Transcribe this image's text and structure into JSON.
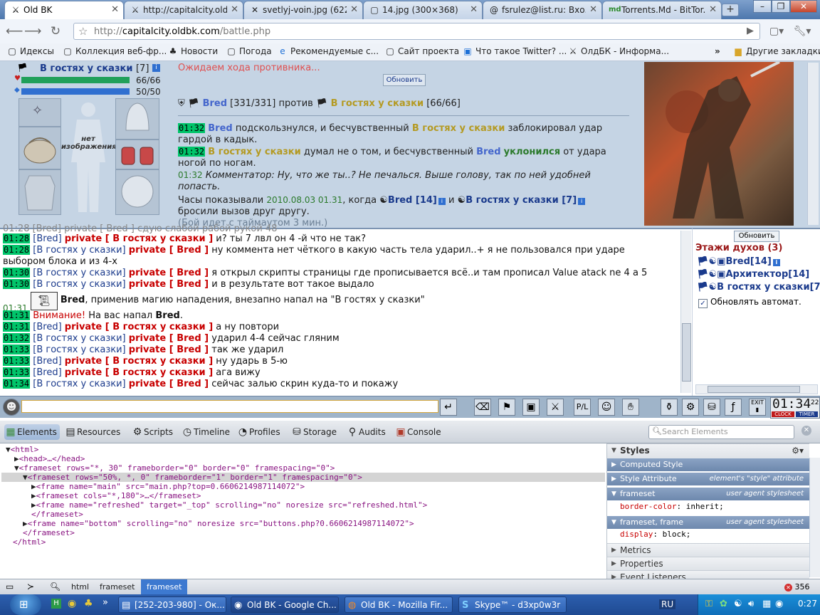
{
  "browser": {
    "tabs": [
      {
        "icon": "⚔",
        "label": "Old BK"
      },
      {
        "icon": "⚔",
        "label": "http://capitalcity.old..."
      },
      {
        "icon": "✕",
        "label": "svetlyj-voin.jpg (622..."
      },
      {
        "icon": "▢",
        "label": "14.jpg (300×368)"
      },
      {
        "icon": "@",
        "label": "fsrulez@list.ru: Вхо..."
      },
      {
        "icon": "md",
        "label": "Torrents.Md - BitTor..."
      }
    ],
    "url_prefix": "http://",
    "url_domain": "capitalcity.oldbk.com",
    "url_path": "/battle.php",
    "bookmarks": [
      {
        "icon": "▢",
        "label": "Идексы"
      },
      {
        "icon": "▢",
        "label": "Коллекция веб-фр..."
      },
      {
        "icon": "♣",
        "label": "Новости"
      },
      {
        "icon": "▢",
        "label": "Погода"
      },
      {
        "icon": "e",
        "label": "Рекомендуемые с..."
      },
      {
        "icon": "▢",
        "label": "Сайт проекта"
      },
      {
        "icon": "▣",
        "label": "Что такое Twitter? ..."
      },
      {
        "icon": "⚔",
        "label": "ОлдБК - Информа..."
      }
    ],
    "other_bookmarks": "Другие закладки",
    "chevron": "»"
  },
  "game": {
    "player_name": "В гостях у сказки",
    "player_level": "[7]",
    "hp": "66/66",
    "hp_fraction": 1.0,
    "mana": "50/50",
    "mana_fraction": 1.0,
    "no_image": "нет изображения",
    "waiting": "Ожидаем хода противника...",
    "refresh_btn": "Обновить",
    "fighter1": "Bred",
    "fighter1_hp": "[331/331]",
    "versus": "против",
    "fighter2": "В гостях у сказки",
    "fighter2_hp": "[66/66]",
    "log": [
      {
        "time": "01:32",
        "a": "Bred",
        "text1": " подскользнулся, и бесчувственный ",
        "b": "В гостях у сказки",
        "text2": " заблокировал удар",
        "line2": "гардой в кадык."
      },
      {
        "time": "01:32",
        "a": "В гостях у сказки",
        "text1": " думал не о том, и бесчувственный ",
        "b": "Bred",
        "text2": " от удара",
        "dodge": "уклонился",
        "line2": "ногой по ногам."
      },
      {
        "time": "01:32",
        "comment": "Комментатор: Ну, что же ты..? Не печалься. Выше голову, так по ней удобней",
        "line2": "попасть."
      }
    ],
    "clock_text1": "Часы показывали ",
    "clock_date": "2010.08.03 01.31",
    "clock_text2": ", когда ",
    "clock_p1": "Bred [14]",
    "clock_and": " и ",
    "clock_p2": "В гостях у сказки [7]",
    "clock_line2": "бросили вызов друг другу.",
    "timeout": "(Бой идет с таймаутом 3 мин.)"
  },
  "chat": {
    "cut_line": "01:28 [Bred] private [ Bred ] сдую слабой рабой рукой 48",
    "lines": [
      {
        "time": "01:28",
        "who": "[Bred]",
        "to": "private [ В гостях у сказки ]",
        "msg": " и? ты 7 лвл он 4 -й что не так?"
      },
      {
        "time": "01:28",
        "who": "[В гостях у сказки]",
        "to": "private [ Bred ]",
        "msg": " ну коммента нет чёткого в какую часть тела ударил..+ я не пользовался при ударе"
      },
      {
        "cont": "выбором блока и из 4-х"
      },
      {
        "time": "01:30",
        "who": "[В гостях у сказки]",
        "to": "private [ Bred ]",
        "msg": " я открыл скрипты страницы где прописывается всё..и там прописал Value atack ne 4 a 5"
      },
      {
        "time": "01:30",
        "who": "[В гостях у сказки]",
        "to": "private [ Bred ]",
        "msg": " и в результате вот такое выдало"
      }
    ],
    "magic_time": "01:31",
    "magic_who": "Bred",
    "magic_text": ", применив магию нападения, внезапно напал на \"В гостях у сказки\"",
    "attack_time": "01:31",
    "attack_warn": "Внимание!",
    "attack_text": " На вас напал ",
    "attack_who": "Bred",
    "lines2": [
      {
        "time": "01:31",
        "who": "[Bred]",
        "to": "private [ В гостях у сказки ]",
        "msg": " а ну повтори"
      },
      {
        "time": "01:32",
        "who": "[В гостях у сказки]",
        "to": "private [ Bred ]",
        "msg": " ударил 4-4 сейчас гляним"
      },
      {
        "time": "01:33",
        "who": "[В гостях у сказки]",
        "to": "private [ Bred ]",
        "msg": " так же ударил"
      },
      {
        "time": "01:33",
        "who": "[Bred]",
        "to": "private [ В гостях у сказки ]",
        "msg": " ну ударь в 5-ю"
      },
      {
        "time": "01:33",
        "who": "[Bred]",
        "to": "private [ В гостях у сказки ]",
        "msg": " ага вижу"
      },
      {
        "time": "01:34",
        "who": "[В гостях у сказки]",
        "to": "private [ Bred ]",
        "msg": " сейчас залью скрин куда-то и покажу"
      }
    ]
  },
  "side": {
    "refresh": "Обновить",
    "title": "Этажи духов (3)",
    "players": [
      "Bred[14]",
      "Архитектор[14]",
      "В гостях у сказки[7"
    ],
    "auto_refresh": "Обновлять автомат."
  },
  "gamebar": {
    "clock": "01:34",
    "clock_sec": "22",
    "clock_label": "CLOCK",
    "timer_label": "TIMER",
    "exit_label": "EXIT"
  },
  "devtools": {
    "tabs": [
      "Elements",
      "Resources",
      "Scripts",
      "Timeline",
      "Profiles",
      "Storage",
      "Audits",
      "Console"
    ],
    "search_placeholder": "Search Elements",
    "dom": [
      "<html>",
      "<head>…</head>",
      "<frameset rows=\"*, 30\" frameborder=\"0\" border=\"0\" framespacing=\"0\">",
      "<frameset rows=\"50%, *, 0\" frameborder=\"1\" border=\"1\" framespacing=\"0\">",
      "<frame name=\"main\" src=\"main.php?top=0.6606214987114072\">",
      "<frameset cols=\"*,180\">…</frameset>",
      "<frame name=\"refreshed\" target=\"_top\" scrolling=\"no\" noresize src=\"refreshed.html\">",
      "</frameset>",
      "<frame name=\"bottom\" scrolling=\"no\" noresize src=\"buttons.php?0.6606214987114072\">",
      "</frameset>",
      "</html>"
    ],
    "styles_title": "Styles",
    "computed": "Computed Style",
    "style_attr": "Style Attribute",
    "style_attr_right": "element's \"style\" attribute",
    "rule1_sel": "frameset",
    "rule1_src": "user agent stylesheet",
    "rule1_prop": "border-color",
    "rule1_val": "inherit",
    "rule2_sel": "frameset, frame",
    "rule2_src": "user agent stylesheet",
    "rule2_prop": "display",
    "rule2_val": "block",
    "metrics": "Metrics",
    "properties": "Properties",
    "event_listeners": "Event Listeners",
    "breadcrumbs": [
      "html",
      "frameset",
      "frameset"
    ],
    "error_count": "356"
  },
  "taskbar": {
    "items": [
      {
        "icon": "▤",
        "label": "[252-203-980] - Ок..."
      },
      {
        "icon": "◉",
        "label": "Old BK - Google Ch..."
      },
      {
        "icon": "◍",
        "label": "Old BK - Mozilla Fir..."
      },
      {
        "icon": "S",
        "label": "Skype™ - d3xp0w3r"
      }
    ],
    "lang": "RU",
    "time": "0:27"
  }
}
